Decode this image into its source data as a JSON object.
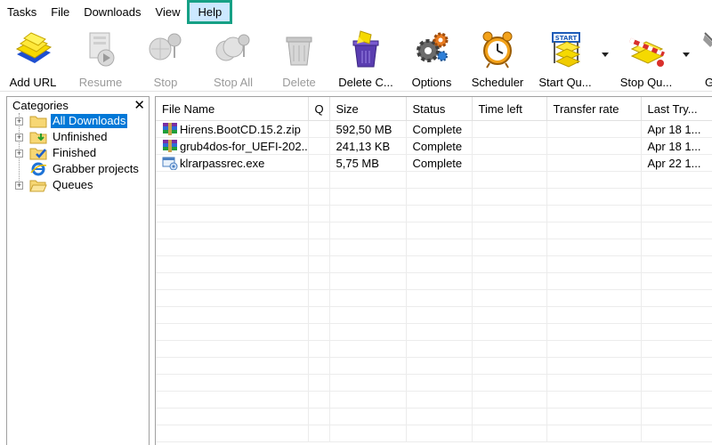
{
  "menu": {
    "items": [
      "Tasks",
      "File",
      "Downloads",
      "View",
      "Help"
    ],
    "active": "Help"
  },
  "toolbar": {
    "add_url": "Add URL",
    "resume": "Resume",
    "stop": "Stop",
    "stop_all": "Stop All",
    "delete": "Delete",
    "delete_completed": "Delete C...",
    "options": "Options",
    "scheduler": "Scheduler",
    "start_queue": "Start Qu...",
    "stop_queue": "Stop Qu...",
    "grabber": "G",
    "start_sign_text": "START"
  },
  "categories": {
    "title": "Categories",
    "close": "✕",
    "items": [
      {
        "label": "All Downloads",
        "selected": true
      },
      {
        "label": "Unfinished"
      },
      {
        "label": "Finished"
      },
      {
        "label": "Grabber projects"
      },
      {
        "label": "Queues"
      }
    ]
  },
  "downloads": {
    "columns": [
      "File Name",
      "Q",
      "Size",
      "Status",
      "Time left",
      "Transfer rate",
      "Last Try..."
    ],
    "rows": [
      {
        "name": "Hirens.BootCD.15.2.zip",
        "q": "",
        "size": "592,50  MB",
        "status": "Complete",
        "time_left": "",
        "rate": "",
        "last_try": "Apr 18 1..."
      },
      {
        "name": "grub4dos-for_UEFI-202...",
        "q": "",
        "size": "241,13  KB",
        "status": "Complete",
        "time_left": "",
        "rate": "",
        "last_try": "Apr 18 1..."
      },
      {
        "name": "klrarpassrec.exe",
        "q": "",
        "size": "5,75  MB",
        "status": "Complete",
        "time_left": "",
        "rate": "",
        "last_try": "Apr 22 1..."
      }
    ]
  },
  "colors": {
    "selection": "#0078d7",
    "menu_highlight": "#cce8ff",
    "menu_outline": "#16a085"
  }
}
